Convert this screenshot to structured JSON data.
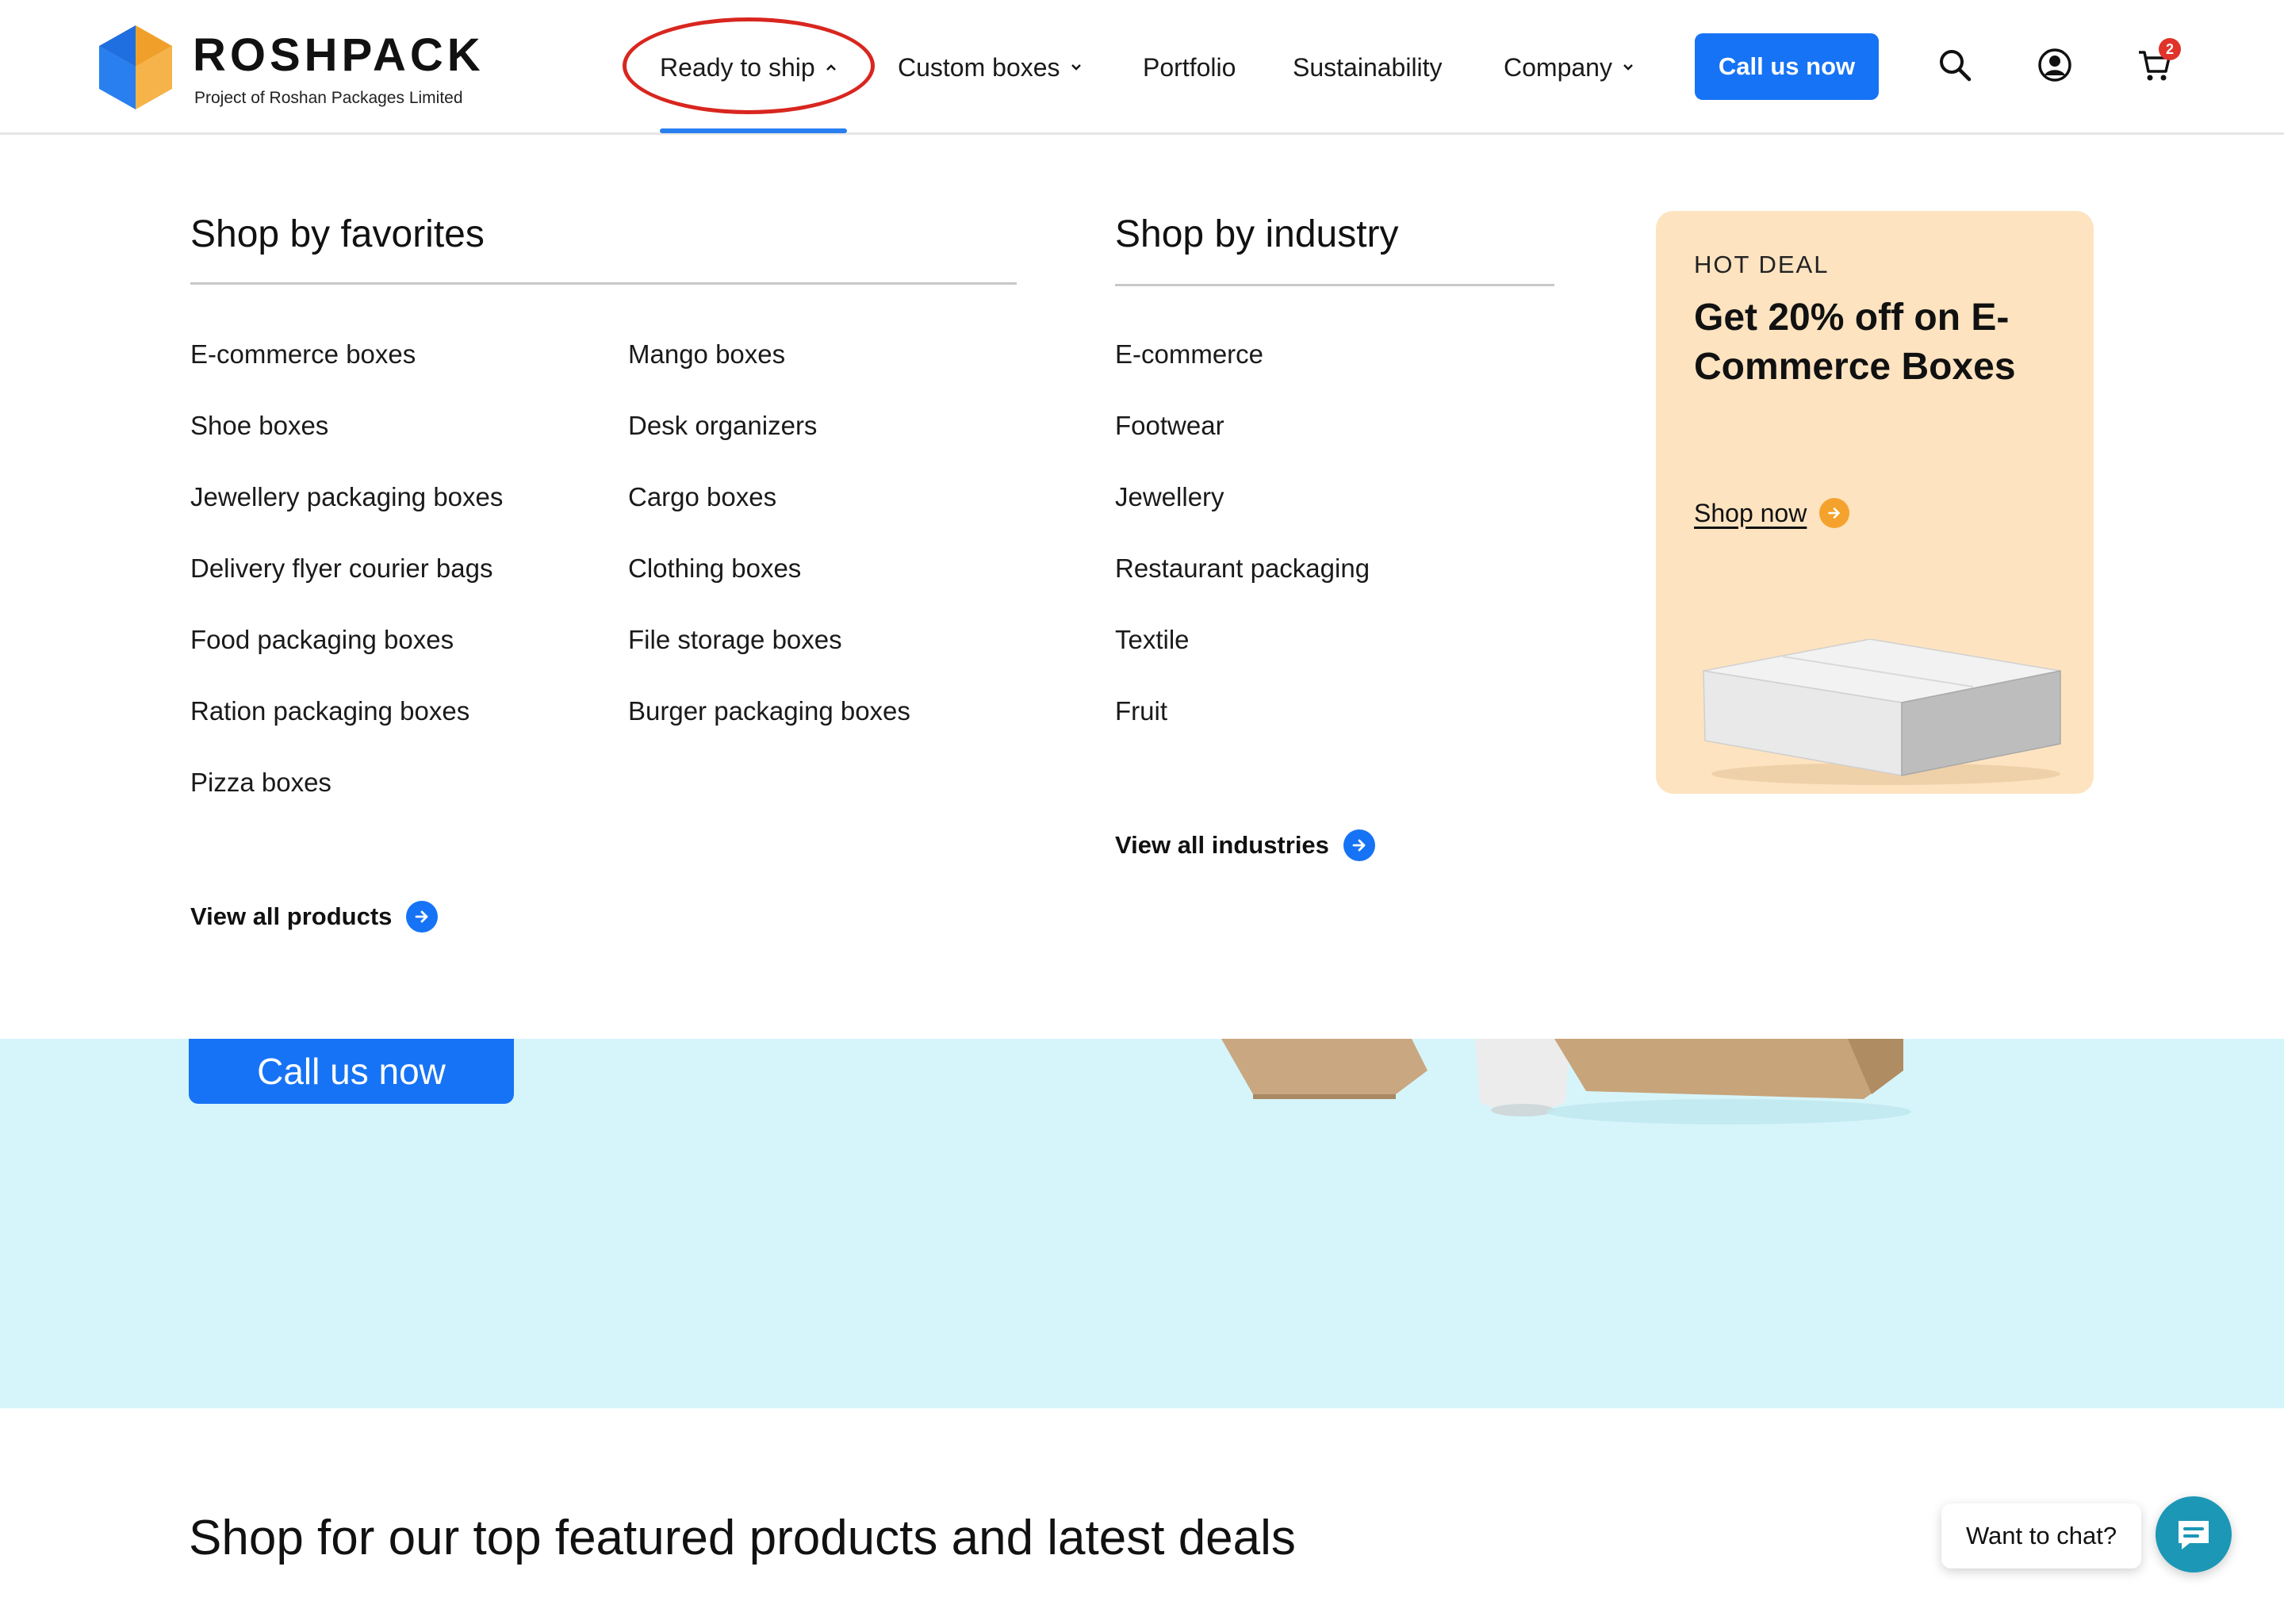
{
  "brand": {
    "name": "ROSHPACK",
    "tagline": "Project of Roshan Packages Limited"
  },
  "nav": {
    "items": [
      {
        "label": "Ready to ship",
        "active": true
      },
      {
        "label": "Custom boxes"
      },
      {
        "label": "Portfolio"
      },
      {
        "label": "Sustainability"
      },
      {
        "label": "Company"
      }
    ],
    "call_button": "Call us now",
    "cart_count": "2"
  },
  "mega_menu": {
    "favorites": {
      "title": "Shop by favorites",
      "col1": [
        "E-commerce boxes",
        "Shoe boxes",
        "Jewellery packaging boxes",
        "Delivery flyer courier bags",
        "Food packaging boxes",
        "Ration packaging boxes",
        "Pizza boxes"
      ],
      "col2": [
        "Mango boxes",
        "Desk organizers",
        "Cargo boxes",
        "Clothing boxes",
        "File storage boxes",
        "Burger packaging boxes"
      ],
      "view_all": "View all products"
    },
    "industry": {
      "title": "Shop by industry",
      "items": [
        "E-commerce",
        "Footwear",
        "Jewellery",
        "Restaurant packaging",
        "Textile",
        "Fruit"
      ],
      "view_all": "View all industries"
    },
    "deal": {
      "tag": "HOT DEAL",
      "title": "Get 20% off on E-Commerce Boxes",
      "cta": "Shop now"
    }
  },
  "hero": {
    "call_button": "Call us now"
  },
  "featured": {
    "title": "Shop for our top featured products and latest deals"
  },
  "chat": {
    "label": "Want to chat?"
  },
  "colors": {
    "accent": "#1673f5",
    "deal_bg": "#fde3c0",
    "hero_bg": "#d6f5fb",
    "annotation": "#d8261f",
    "chat": "#1c97b6"
  }
}
